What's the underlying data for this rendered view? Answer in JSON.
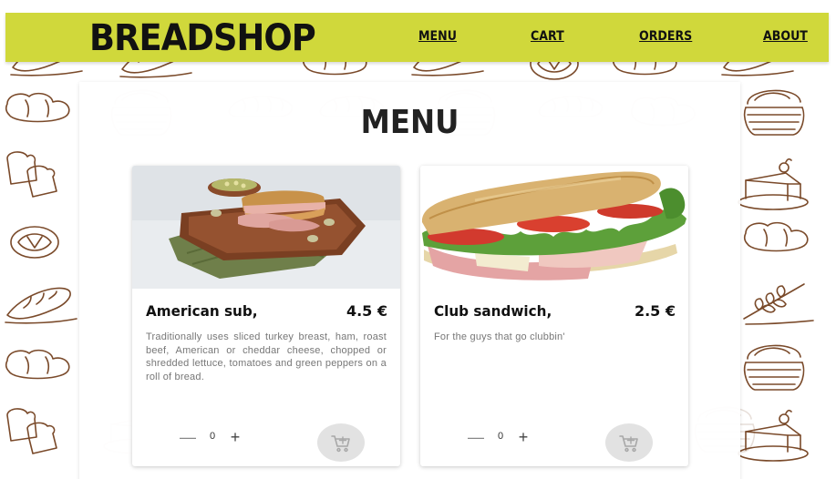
{
  "header": {
    "brand": "BREADSHOP",
    "nav": {
      "menu": "MENU",
      "cart": "CART",
      "orders": "ORDERS",
      "about": "ABOUT"
    }
  },
  "main": {
    "title": "MENU",
    "products": [
      {
        "name": "American sub,",
        "price": "4.5 €",
        "description": "Traditionally uses sliced turkey breast, ham, roast beef, American or cheddar cheese, chopped or shredded lettuce, tomatoes and green peppers on a roll of bread.",
        "quantity": "0",
        "minus": "—",
        "plus": "+",
        "cart_icon": "add-to-cart-icon"
      },
      {
        "name": "Club sandwich,",
        "price": "2.5 €",
        "description": "For the guys that go clubbin'",
        "quantity": "0",
        "minus": "—",
        "plus": "+",
        "cart_icon": "add-to-cart-icon"
      }
    ]
  },
  "colors": {
    "header_bg": "#d0d83b",
    "doodle_stroke": "#7a4a2a",
    "cart_button_bg": "#e2e2e2"
  }
}
